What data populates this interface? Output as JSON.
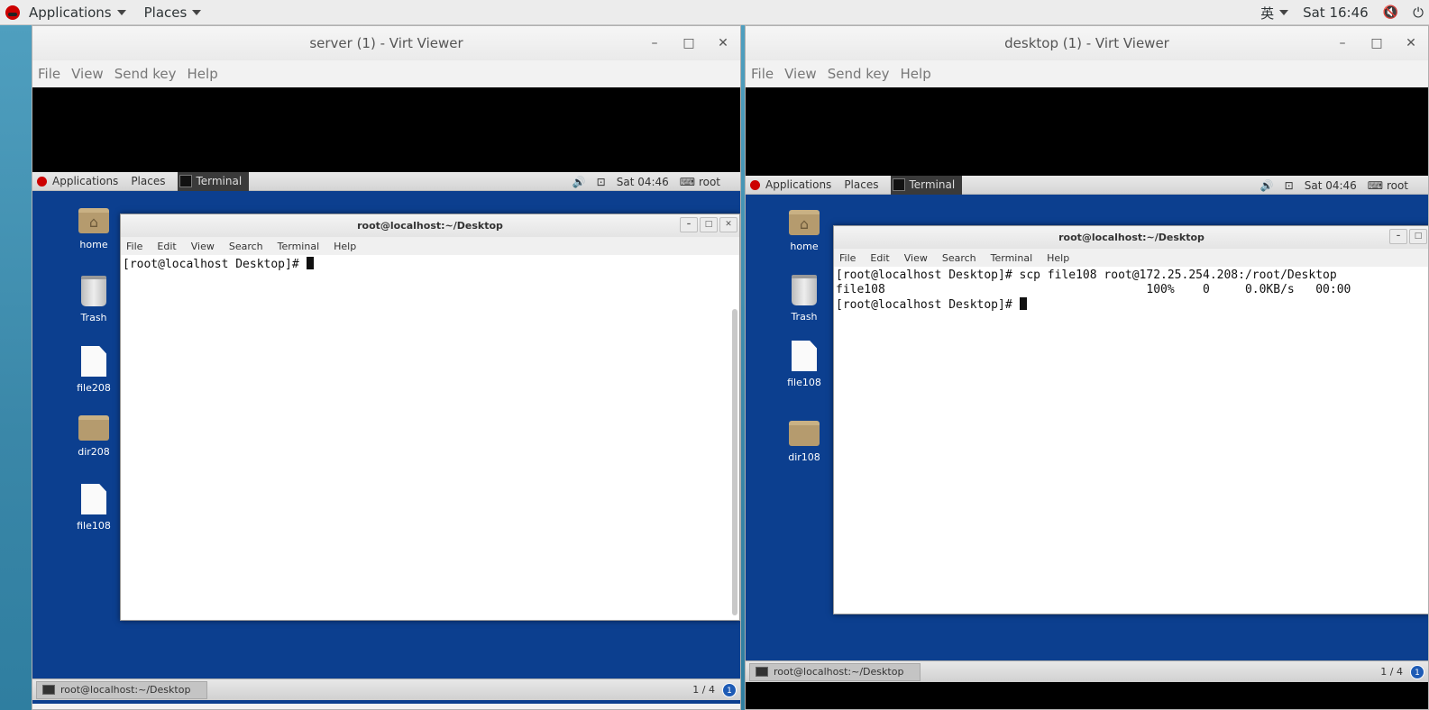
{
  "host": {
    "applications_label": "Applications",
    "places_label": "Places",
    "input_method": "英",
    "clock": "Sat 16:46"
  },
  "server": {
    "window_title": "server (1) - Virt Viewer",
    "menu": [
      "File",
      "View",
      "Send key",
      "Help"
    ],
    "guest": {
      "applications": "Applications",
      "places": "Places",
      "task": "Terminal",
      "clock": "Sat 04:46",
      "user": "root",
      "icons": [
        "home",
        "Trash",
        "file208",
        "dir208",
        "file108"
      ],
      "terminal_title": "root@localhost:~/Desktop",
      "terminal_menu": [
        "File",
        "Edit",
        "View",
        "Search",
        "Terminal",
        "Help"
      ],
      "terminal_lines": [
        "[root@localhost Desktop]# "
      ],
      "taskbar_item": "root@localhost:~/Desktop",
      "workspace": "1 / 4",
      "workspace_badge": "1"
    }
  },
  "desktop": {
    "window_title": "desktop (1) - Virt Viewer",
    "menu": [
      "File",
      "View",
      "Send key",
      "Help"
    ],
    "guest": {
      "applications": "Applications",
      "places": "Places",
      "task": "Terminal",
      "clock": "Sat 04:46",
      "user": "root",
      "icons": [
        "home",
        "Trash",
        "file108",
        "dir108"
      ],
      "terminal_title": "root@localhost:~/Desktop",
      "terminal_menu": [
        "File",
        "Edit",
        "View",
        "Search",
        "Terminal",
        "Help"
      ],
      "terminal_lines": [
        "[root@localhost Desktop]# scp file108 root@172.25.254.208:/root/Desktop",
        "file108                                     100%    0     0.0KB/s   00:00",
        "[root@localhost Desktop]# "
      ],
      "taskbar_item": "root@localhost:~/Desktop",
      "workspace": "1 / 4",
      "workspace_badge": "1"
    }
  },
  "colors": {
    "guest_desktop": "#0c3f8f",
    "host_desktop": "#3a87a8"
  }
}
